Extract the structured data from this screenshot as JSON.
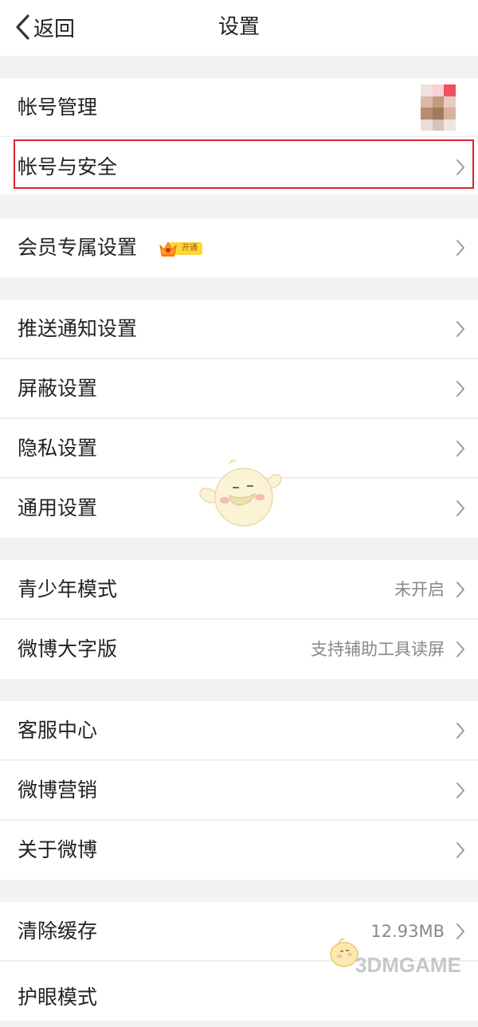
{
  "header": {
    "back_label": "返回",
    "title": "设置"
  },
  "groups": [
    {
      "rows": [
        {
          "label": "帐号管理",
          "accessory": "avatar"
        },
        {
          "label": "帐号与安全",
          "highlighted": true
        }
      ]
    },
    {
      "rows": [
        {
          "label": "会员专属设置",
          "badge": "开通"
        }
      ]
    },
    {
      "rows": [
        {
          "label": "推送通知设置"
        },
        {
          "label": "屏蔽设置"
        },
        {
          "label": "隐私设置"
        },
        {
          "label": "通用设置"
        }
      ]
    },
    {
      "rows": [
        {
          "label": "青少年模式",
          "value": "未开启"
        },
        {
          "label": "微博大字版",
          "value": "支持辅助工具读屏"
        }
      ]
    },
    {
      "rows": [
        {
          "label": "客服中心"
        },
        {
          "label": "微博营销"
        },
        {
          "label": "关于微博"
        }
      ]
    },
    {
      "rows": [
        {
          "label": "清除缓存",
          "value": "12.93MB"
        },
        {
          "label": "护眼模式"
        }
      ]
    }
  ],
  "watermark": {
    "text": "3DMGAME"
  },
  "colors": {
    "highlight_border": "#d6262d",
    "page_background": "#f2f2f2",
    "row_background": "#ffffff",
    "secondary_text": "#888888",
    "vip_badge": "#ffd43d"
  },
  "icons": {
    "back": "chevron-left-icon",
    "row_arrow": "chevron-right-icon",
    "vip": "crown-icon"
  }
}
